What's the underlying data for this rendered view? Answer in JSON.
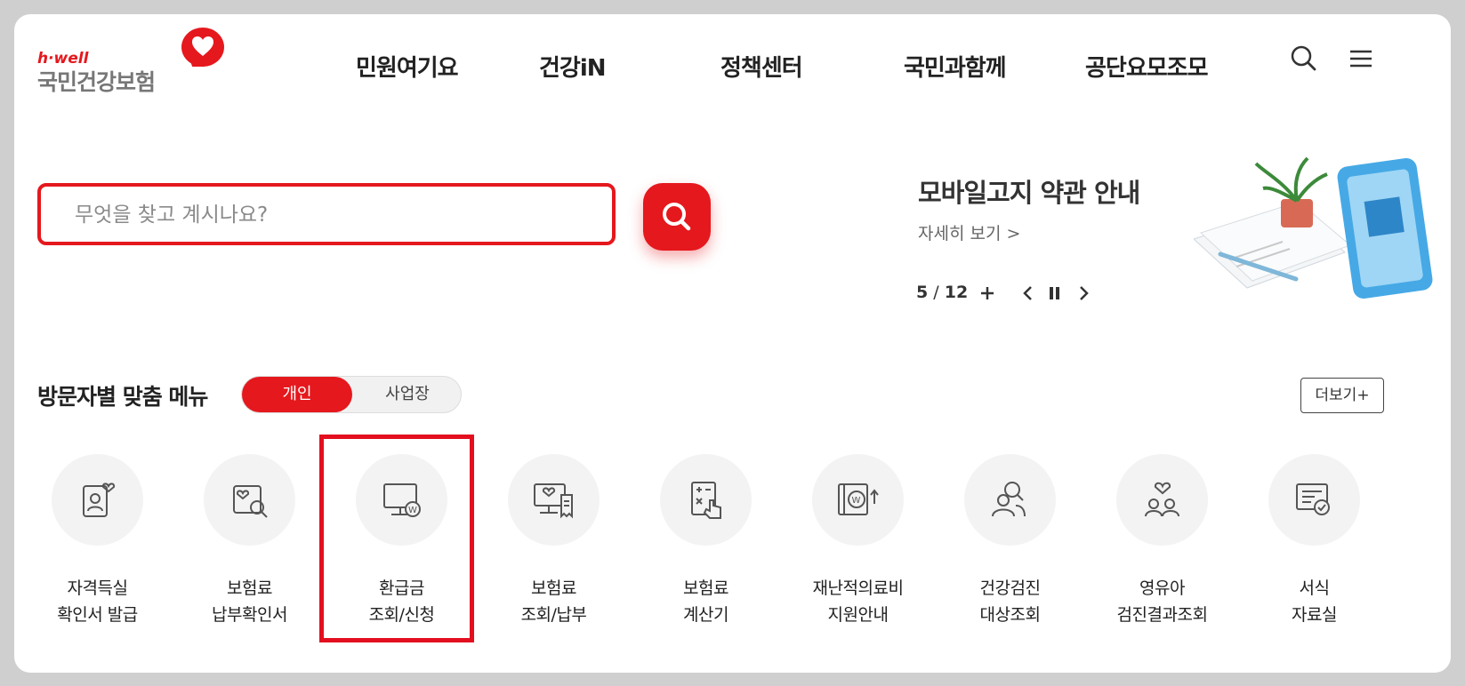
{
  "header": {
    "logo_top": "h·well",
    "logo_name": "국민건강보험",
    "nav": [
      "민원여기요",
      "건강iN",
      "정책센터",
      "국민과함께",
      "공단요모조모"
    ]
  },
  "search": {
    "placeholder": "무엇을 찾고 계시나요?"
  },
  "banner": {
    "title": "모바일고지 약관 안내",
    "more_label": "자세히 보기 >",
    "current": "5",
    "separator": "/",
    "total": "12"
  },
  "custom_menu": {
    "title": "방문자별 맞춤 메뉴",
    "toggle": [
      "개인",
      "사업장"
    ],
    "more_label": "더보기+",
    "items": [
      {
        "line1": "자격득실",
        "line2": "확인서 발급",
        "icon": "person-card-icon"
      },
      {
        "line1": "보험료",
        "line2": "납부확인서",
        "icon": "document-search-icon"
      },
      {
        "line1": "환급금",
        "line2": "조회/신청",
        "icon": "monitor-won-icon"
      },
      {
        "line1": "보험료",
        "line2": "조회/납부",
        "icon": "monitor-receipt-icon"
      },
      {
        "line1": "보험료",
        "line2": "계산기",
        "icon": "calculator-hand-icon"
      },
      {
        "line1": "재난적의료비",
        "line2": "지원안내",
        "icon": "book-won-icon"
      },
      {
        "line1": "건강검진",
        "line2": "대상조회",
        "icon": "people-search-icon"
      },
      {
        "line1": "영유아",
        "line2": "검진결과조회",
        "icon": "family-heart-icon"
      },
      {
        "line1": "서식",
        "line2": "자료실",
        "icon": "document-check-icon"
      }
    ]
  },
  "colors": {
    "brand_red": "#e5181d",
    "highlight_red": "#e30f1f"
  }
}
